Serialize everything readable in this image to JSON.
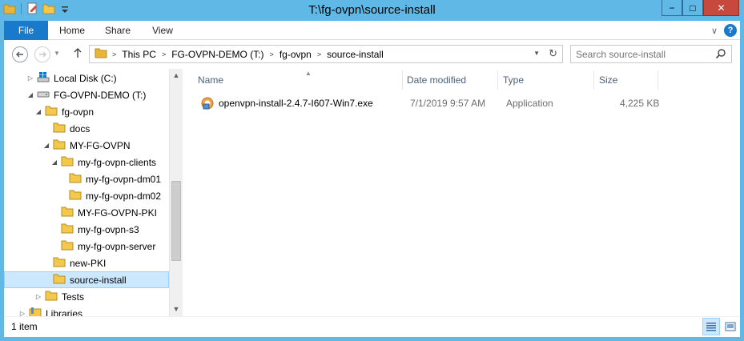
{
  "window": {
    "title": "T:\\fg-ovpn\\source-install",
    "minimize_symbol": "−",
    "maximize_symbol": "□",
    "close_symbol": "✕"
  },
  "ribbon": {
    "file_label": "File",
    "tabs": [
      "Home",
      "Share",
      "View"
    ],
    "expand_symbol": "∨",
    "help_symbol": "?"
  },
  "address": {
    "crumbs": [
      "This PC",
      "FG-OVPN-DEMO (T:)",
      "fg-ovpn",
      "source-install"
    ]
  },
  "search": {
    "placeholder": "Search source-install"
  },
  "nav_tree": [
    {
      "label": "Local Disk (C:)",
      "icon": "drive-icon",
      "expander": "collapsed"
    },
    {
      "label": "FG-OVPN-DEMO (T:)",
      "icon": "usb-drive-icon",
      "expander": "expanded"
    },
    {
      "label": "fg-ovpn",
      "icon": "folder-icon",
      "expander": "expanded"
    },
    {
      "label": "docs",
      "icon": "folder-icon",
      "expander": "none"
    },
    {
      "label": "MY-FG-OVPN",
      "icon": "folder-icon",
      "expander": "expanded"
    },
    {
      "label": "my-fg-ovpn-clients",
      "icon": "folder-icon",
      "expander": "expanded"
    },
    {
      "label": "my-fg-ovpn-dm01",
      "icon": "folder-icon",
      "expander": "none"
    },
    {
      "label": "my-fg-ovpn-dm02",
      "icon": "folder-icon",
      "expander": "none"
    },
    {
      "label": "MY-FG-OVPN-PKI",
      "icon": "folder-icon",
      "expander": "none"
    },
    {
      "label": "my-fg-ovpn-s3",
      "icon": "folder-icon",
      "expander": "none"
    },
    {
      "label": "my-fg-ovpn-server",
      "icon": "folder-icon",
      "expander": "none"
    },
    {
      "label": "new-PKI",
      "icon": "folder-icon",
      "expander": "none"
    },
    {
      "label": "source-install",
      "icon": "folder-icon",
      "expander": "none",
      "selected": true
    },
    {
      "label": "Tests",
      "icon": "folder-icon",
      "expander": "collapsed"
    },
    {
      "label": "Libraries",
      "icon": "libraries-icon",
      "expander": "collapsed"
    }
  ],
  "columns": {
    "name": "Name",
    "date_modified": "Date modified",
    "type": "Type",
    "size": "Size"
  },
  "files": [
    {
      "name": "openvpn-install-2.4.7-I607-Win7.exe",
      "date_modified": "7/1/2019 9:57 AM",
      "type": "Application",
      "size": "4,225 KB",
      "icon": "installer-icon"
    }
  ],
  "status": {
    "item_count": "1 item"
  }
}
